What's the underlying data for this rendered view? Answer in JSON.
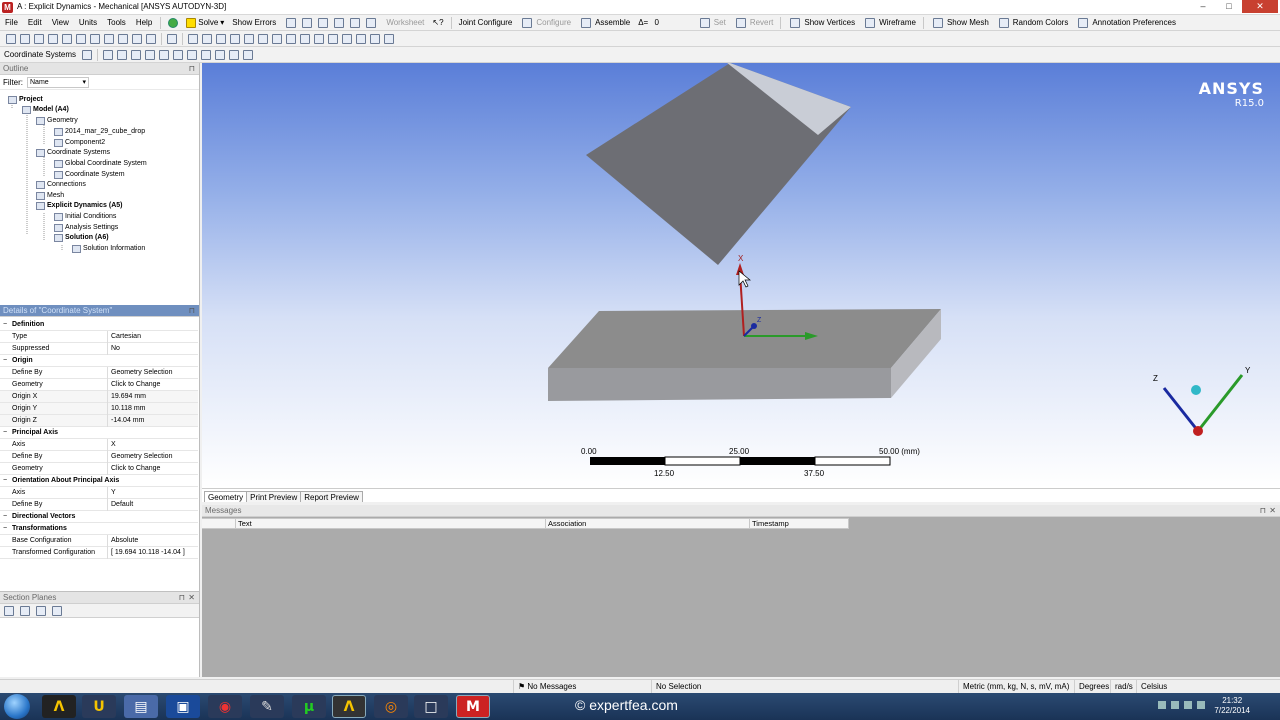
{
  "window": {
    "title": "A : Explicit Dynamics - Mechanical [ANSYS AUTODYN-3D]",
    "minimize": "–",
    "maximize": "□",
    "close": "✕"
  },
  "menu": [
    "File",
    "Edit",
    "View",
    "Units",
    "Tools",
    "Help"
  ],
  "toolbar1": {
    "solve": "Solve",
    "show_errors": "Show Errors",
    "worksheet": "Worksheet",
    "joint_configure": "Joint Configure",
    "configure": "Configure",
    "assemble": "Assemble",
    "delta_label": "Δ=",
    "delta_value": "0",
    "set": "Set",
    "revert": "Revert",
    "show_vertices": "Show Vertices",
    "wireframe": "Wireframe",
    "show_mesh": "Show Mesh",
    "random_colors": "Random Colors",
    "annotation_preferences": "Annotation Preferences"
  },
  "toolbar3": {
    "context_label": "Coordinate Systems"
  },
  "outline": {
    "title": "Outline",
    "filter_label": "Filter:",
    "filter_value": "Name",
    "tree": [
      {
        "label": "Project",
        "bold": true
      },
      {
        "label": "Model (A4)",
        "bold": true
      },
      {
        "label": "Geometry",
        "bold": false
      },
      {
        "label": "2014_mar_29_cube_drop",
        "bold": false
      },
      {
        "label": "Component2",
        "bold": false
      },
      {
        "label": "Coordinate Systems",
        "bold": false
      },
      {
        "label": "Global Coordinate System",
        "bold": false
      },
      {
        "label": "Coordinate System",
        "bold": false
      },
      {
        "label": "Connections",
        "bold": false
      },
      {
        "label": "Mesh",
        "bold": false
      },
      {
        "label": "Explicit Dynamics (A5)",
        "bold": true
      },
      {
        "label": "Initial Conditions",
        "bold": false
      },
      {
        "label": "Analysis Settings",
        "bold": false
      },
      {
        "label": "Solution (A6)",
        "bold": true
      },
      {
        "label": "Solution Information",
        "bold": false
      }
    ]
  },
  "details": {
    "title": "Details of \"Coordinate System\"",
    "rows": [
      {
        "group": "Definition"
      },
      {
        "k": "Type",
        "v": "Cartesian"
      },
      {
        "k": "Suppressed",
        "v": "No"
      },
      {
        "group": "Origin"
      },
      {
        "k": "Define By",
        "v": "Geometry Selection"
      },
      {
        "k": "Geometry",
        "v": "Click to Change"
      },
      {
        "k": "Origin X",
        "v": "19.694 mm",
        "shade": true
      },
      {
        "k": "Origin Y",
        "v": "10.118 mm",
        "shade": true
      },
      {
        "k": "Origin Z",
        "v": "-14.04 mm",
        "shade": true
      },
      {
        "group": "Principal Axis"
      },
      {
        "k": "Axis",
        "v": "X"
      },
      {
        "k": "Define By",
        "v": "Geometry Selection"
      },
      {
        "k": "Geometry",
        "v": "Click to Change"
      },
      {
        "group": "Orientation About Principal Axis"
      },
      {
        "k": "Axis",
        "v": "Y"
      },
      {
        "k": "Define By",
        "v": "Default"
      },
      {
        "group": "Directional Vectors"
      },
      {
        "group": "Transformations"
      },
      {
        "k": "Base Configuration",
        "v": "Absolute"
      },
      {
        "k": "Transformed Configuration",
        "v": "[ 19.694  10.118  -14.04 ]"
      }
    ]
  },
  "section_planes": {
    "title": "Section Planes"
  },
  "viewport": {
    "logo": "ANSYS",
    "version": "R15.0",
    "scale_top": [
      "0.00",
      "25.00",
      "50.00 (mm)"
    ],
    "scale_bottom": [
      "12.50",
      "37.50"
    ],
    "axis_x": "X",
    "axis_z": "Z",
    "triad_z": "Z",
    "triad_y": "Y"
  },
  "view_tabs": [
    "Geometry",
    "Print Preview",
    "Report Preview"
  ],
  "messages": {
    "title": "Messages",
    "columns": [
      "Text",
      "Association",
      "Timestamp"
    ]
  },
  "status": {
    "messages": "No Messages",
    "selection": "No Selection",
    "units": "Metric (mm, kg, N, s, mV, mA)",
    "angle": "Degrees",
    "rate": "rad/s",
    "temperature": "Celsius"
  },
  "taskbar": {
    "watermark": "© expertfea.com",
    "time": "21:32",
    "date": "7/22/2014"
  },
  "colors": {
    "accent": "#6f8fbf",
    "viewport_top": "#5a7ed8",
    "close_red": "#c84030",
    "axis_x_red": "#c03030",
    "axis_y_green": "#2a9a2a",
    "axis_z_blue": "#1a2aa0"
  }
}
